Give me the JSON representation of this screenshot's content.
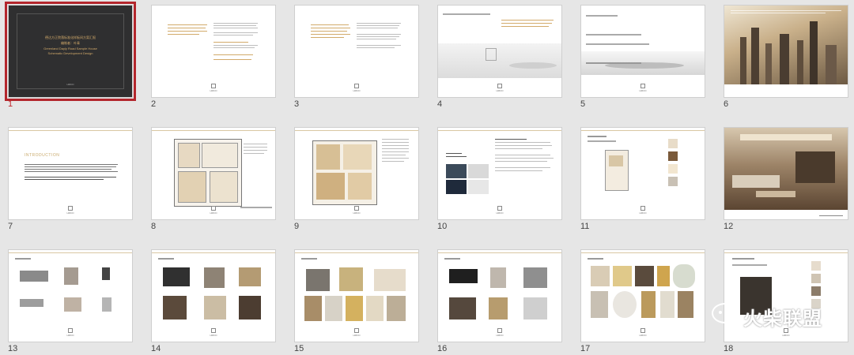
{
  "slides": [
    {
      "number": "1",
      "title_cn": "德达方正院落标准化样板间方案汇报",
      "sub_cn": "编制者：叶青",
      "title_en": "Greenland Dayly Road Sample House",
      "sub_en": "Schematic Development Design",
      "logo": "HMCD"
    },
    {
      "number": "2",
      "logo": "HMCD"
    },
    {
      "number": "3",
      "logo": "HMCD"
    },
    {
      "number": "4",
      "logo": "HMCD"
    },
    {
      "number": "5",
      "logo": "HMCD"
    },
    {
      "number": "6"
    },
    {
      "number": "7",
      "heading": "INTRODUCTION",
      "logo": "HMCD"
    },
    {
      "number": "8",
      "logo": "HMCD"
    },
    {
      "number": "9",
      "logo": "HMCD"
    },
    {
      "number": "10",
      "logo": "HMCD"
    },
    {
      "number": "11",
      "logo": "HMCD"
    },
    {
      "number": "12"
    },
    {
      "number": "13",
      "logo": "HMCD"
    },
    {
      "number": "14",
      "logo": "HMCD"
    },
    {
      "number": "15",
      "logo": "HMCD"
    },
    {
      "number": "16",
      "logo": "HMCD"
    },
    {
      "number": "17",
      "logo": "HMCD"
    },
    {
      "number": "18",
      "logo": "HMCD"
    }
  ],
  "watermark": {
    "text": "火柴联盟"
  },
  "colors": {
    "selection": "#b3262c",
    "gold": "#d2aa6a",
    "background": "#e6e6e6"
  }
}
